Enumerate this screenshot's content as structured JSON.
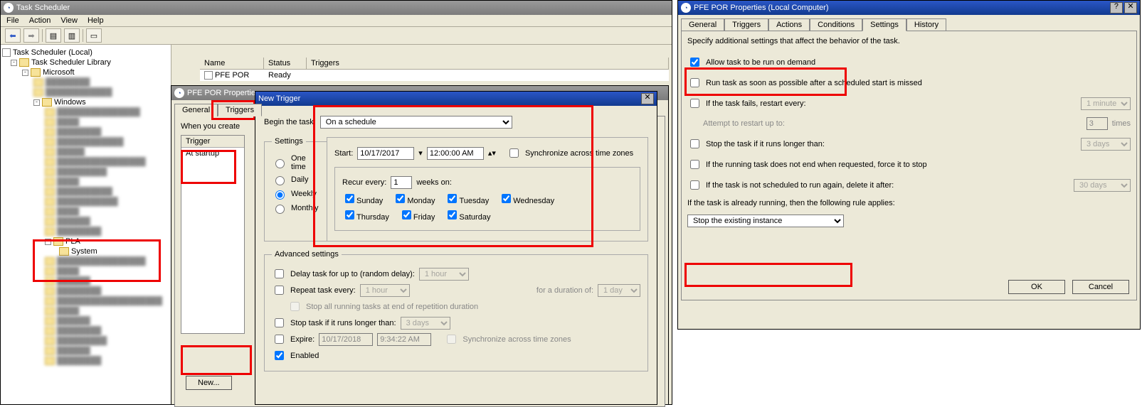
{
  "main": {
    "title": "Task Scheduler",
    "menus": [
      "File",
      "Action",
      "View",
      "Help"
    ],
    "tree": {
      "root": "Task Scheduler (Local)",
      "library": "Task Scheduler Library",
      "microsoft": "Microsoft",
      "windows": "Windows",
      "pla": "PLA",
      "system": "System"
    },
    "list": {
      "headers": [
        "Name",
        "Status",
        "Triggers"
      ],
      "row": {
        "name": "PFE POR",
        "status": "Ready",
        "triggers": ""
      }
    }
  },
  "props1": {
    "title": "PFE POR Properties",
    "tabs": [
      "General",
      "Triggers"
    ],
    "intro": "When you create",
    "trigger_hdr": "Trigger",
    "trigger_val": "At startup",
    "new_btn": "New..."
  },
  "newtrigger": {
    "title": "New Trigger",
    "begin_label": "Begin the task:",
    "begin_value": "On a schedule",
    "settings_legend": "Settings",
    "schedule": {
      "one": "One time",
      "daily": "Daily",
      "weekly": "Weekly",
      "monthly": "Monthly"
    },
    "start_label": "Start:",
    "start_date": "10/17/2017",
    "start_time": "12:00:00 AM",
    "sync_tz": "Synchronize across time zones",
    "recur_label": "Recur every:",
    "recur_value": "1",
    "recur_suffix": "weeks on:",
    "days": [
      "Sunday",
      "Monday",
      "Tuesday",
      "Wednesday",
      "Thursday",
      "Friday",
      "Saturday"
    ],
    "adv_legend": "Advanced settings",
    "delay_label": "Delay task for up to (random delay):",
    "delay_value": "1 hour",
    "repeat_label": "Repeat task every:",
    "repeat_value": "1 hour",
    "duration_label": "for a duration of:",
    "duration_value": "1 day",
    "stop_all": "Stop all running tasks at end of repetition duration",
    "stop_if": "Stop task if it runs longer than:",
    "stop_if_value": "3 days",
    "expire_label": "Expire:",
    "expire_date": "10/17/2018",
    "expire_time": "9:34:22 AM",
    "sync_tz2": "Synchronize across time zones",
    "enabled": "Enabled"
  },
  "props2": {
    "title": "PFE POR Properties (Local Computer)",
    "tabs": [
      "General",
      "Triggers",
      "Actions",
      "Conditions",
      "Settings",
      "History"
    ],
    "intro": "Specify additional settings that affect the behavior of the task.",
    "allow_demand": "Allow task to be run on demand",
    "run_asap": "Run task as soon as possible after a scheduled start is missed",
    "fail_restart": "If the task fails, restart every:",
    "fail_restart_val": "1 minute",
    "attempt_label": "Attempt to restart up to:",
    "attempt_val": "3",
    "attempt_suffix": "times",
    "stop_longer": "Stop the task if it runs longer than:",
    "stop_longer_val": "3 days",
    "force_stop": "If the running task does not end when requested, force it to stop",
    "delete_after": "If the task is not scheduled to run again, delete it after:",
    "delete_after_val": "30 days",
    "already_running": "If the task is already running, then the following rule applies:",
    "rule_value": "Stop the existing instance",
    "ok": "OK",
    "cancel": "Cancel"
  }
}
